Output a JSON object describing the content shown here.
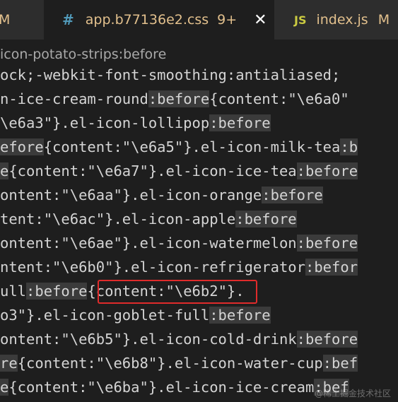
{
  "tabs": {
    "left": {
      "mod": "M"
    },
    "active": {
      "icon": "#",
      "name": "app.b77136e2.css",
      "count": "9+",
      "close": "✕"
    },
    "right": {
      "icon": "JS",
      "name": "index.js",
      "mod": "M"
    }
  },
  "breadcrumb": "icon-potato-strips:before",
  "code_lines": [
    [
      {
        "t": "ock;-webkit-font-smoothing:antialiased;"
      }
    ],
    [
      {
        "t": "n-ice-cream-round"
      },
      {
        "t": ":before",
        "h": true
      },
      {
        "t": "{content:\"\\e6a0\""
      }
    ],
    [
      {
        "t": "\\e6a3\"}.el-icon-lollipop"
      },
      {
        "t": ":before",
        "h": true
      }
    ],
    [
      {
        "t": "efore",
        "h": true
      },
      {
        "t": "{content:\"\\e6a5\"}.el-icon-milk-tea"
      },
      {
        "t": ":b",
        "h": true
      }
    ],
    [
      {
        "t": "e",
        "h": true
      },
      {
        "t": "{content:\"\\e6a7\"}.el-icon-ice-tea"
      },
      {
        "t": ":before",
        "h": true
      }
    ],
    [
      {
        "t": "ontent:\"\\e6aa\"}.el-icon-orange"
      },
      {
        "t": ":before",
        "h": true
      }
    ],
    [
      {
        "t": "tent:\"\\e6ac\"}.el-icon-apple"
      },
      {
        "t": ":before",
        "h": true
      }
    ],
    [
      {
        "t": "ontent:\"\\e6ae\"}.el-icon-watermelon"
      },
      {
        "t": ":before",
        "h": true
      }
    ],
    [
      {
        "t": "ntent:\"\\e6b0\"}.el-icon-refrigerator"
      },
      {
        "t": ":befor",
        "h": true
      }
    ],
    [
      {
        "t": "ull"
      },
      {
        "t": ":before",
        "h": true
      },
      {
        "t": "{content:\"\\e6b2\"}."
      }
    ],
    [
      {
        "t": "o3\"}.el-icon-goblet-full"
      },
      {
        "t": ":before",
        "h": true
      }
    ],
    [
      {
        "t": "ontent:\"\\e6b5\"}.el-icon-cold-drink"
      },
      {
        "t": ":before",
        "h": true
      }
    ],
    [
      {
        "t": "re",
        "h": true
      },
      {
        "t": "{content:\"\\e6b8\"}.el-icon-water-cup"
      },
      {
        "t": ":bef",
        "h": true
      }
    ],
    [
      {
        "t": "e",
        "h": true
      },
      {
        "t": "{content:\"\\e6ba\"}.el-icon-ice-cream"
      },
      {
        "t": ":bef",
        "h": true
      }
    ]
  ],
  "watermark": "@稀土掘金技术社区",
  "colors": {
    "highlight_box": "#e02b2b",
    "modified": "#e2c08d",
    "css_icon": "#519aba",
    "js_icon": "#cbcb41"
  }
}
